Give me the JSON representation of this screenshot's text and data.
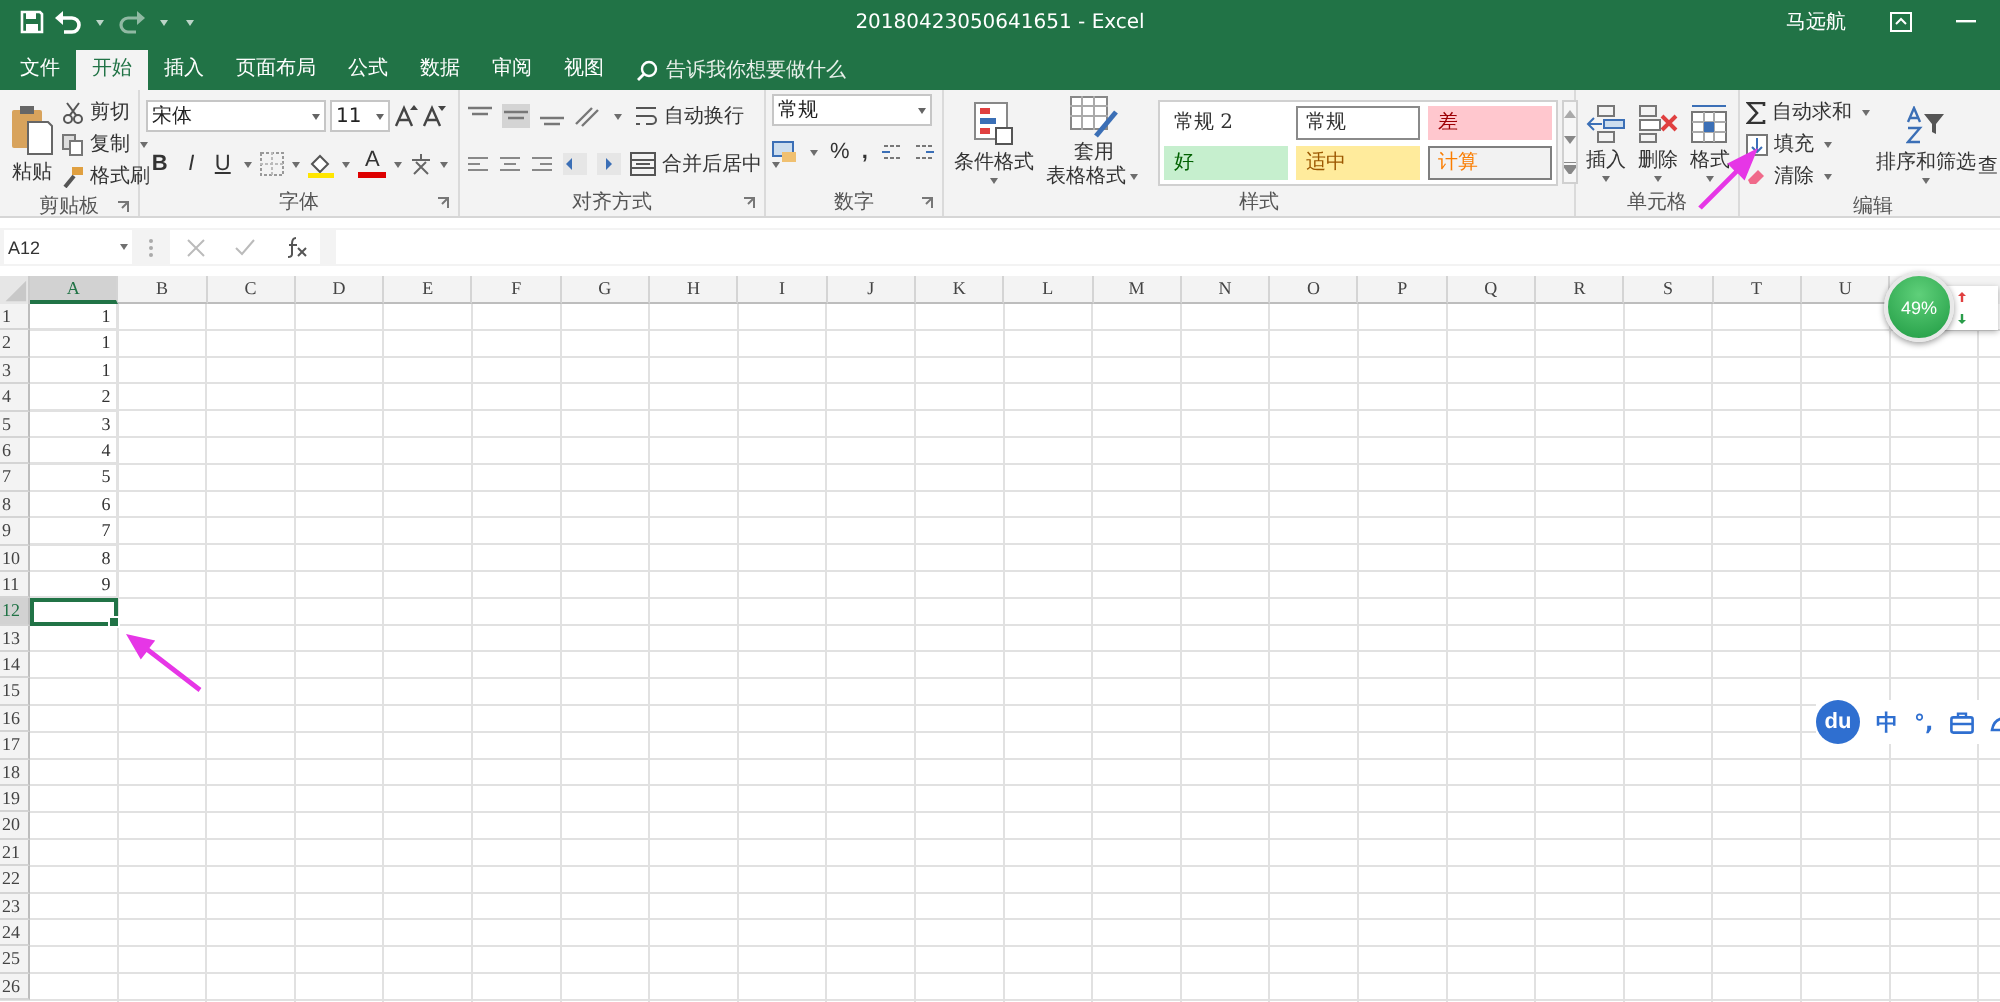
{
  "title_bar": {
    "title": "20180423050641651 - Excel",
    "user": "马远航"
  },
  "tabs": [
    {
      "label": "文件",
      "selected": false
    },
    {
      "label": "开始",
      "selected": true
    },
    {
      "label": "插入",
      "selected": false
    },
    {
      "label": "页面布局",
      "selected": false
    },
    {
      "label": "公式",
      "selected": false
    },
    {
      "label": "数据",
      "selected": false
    },
    {
      "label": "审阅",
      "selected": false
    },
    {
      "label": "视图",
      "selected": false
    }
  ],
  "tell_me": {
    "placeholder": "告诉我你想要做什么"
  },
  "clipboard": {
    "paste": "粘贴",
    "cut": "剪切",
    "copy": "复制",
    "format_painter": "格式刷",
    "label": "剪贴板"
  },
  "font": {
    "name": "宋体",
    "size": "11",
    "bold": "B",
    "italic": "I",
    "underline": "U",
    "font_color": "A",
    "label": "字体"
  },
  "alignment": {
    "wrap": "自动换行",
    "merge": "合并后居中",
    "label": "对齐方式"
  },
  "number": {
    "format": "常规",
    "percent": "%",
    "comma": ",",
    "label": "数字"
  },
  "styles": {
    "conditional": "条件格式",
    "table_top": "套用",
    "table_bottom": "表格格式",
    "label": "样式",
    "cell_styles": [
      {
        "label": "常规 2",
        "kind": "plain"
      },
      {
        "label": "常规",
        "kind": "outlined"
      },
      {
        "label": "差",
        "kind": "bad"
      },
      {
        "label": "好",
        "kind": "good"
      },
      {
        "label": "适中",
        "kind": "neutral"
      },
      {
        "label": "计算",
        "kind": "calculation"
      }
    ]
  },
  "cells_group": {
    "insert": "插入",
    "delete": "删除",
    "format": "格式",
    "label": "单元格"
  },
  "editing": {
    "autosum": "自动求和",
    "fill": "填充",
    "clear": "清除",
    "sort": "排序和筛选",
    "find": "查",
    "label": "编辑"
  },
  "formula_bar": {
    "name_box": "A12"
  },
  "sheet": {
    "columns": [
      {
        "label": "A",
        "selected": true
      },
      {
        "label": "B",
        "selected": false
      },
      {
        "label": "C",
        "selected": false
      },
      {
        "label": "D",
        "selected": false
      },
      {
        "label": "E",
        "selected": false
      },
      {
        "label": "F",
        "selected": false
      },
      {
        "label": "G",
        "selected": false
      },
      {
        "label": "H",
        "selected": false
      },
      {
        "label": "I",
        "selected": false
      },
      {
        "label": "J",
        "selected": false
      },
      {
        "label": "K",
        "selected": false
      },
      {
        "label": "L",
        "selected": false
      },
      {
        "label": "M",
        "selected": false
      },
      {
        "label": "N",
        "selected": false
      },
      {
        "label": "O",
        "selected": false
      },
      {
        "label": "P",
        "selected": false
      },
      {
        "label": "Q",
        "selected": false
      },
      {
        "label": "R",
        "selected": false
      },
      {
        "label": "S",
        "selected": false
      },
      {
        "label": "T",
        "selected": false
      },
      {
        "label": "U",
        "selected": false
      }
    ],
    "rows": [
      {
        "header": "1",
        "a": "1",
        "selected": false
      },
      {
        "header": "2",
        "a": "1",
        "selected": false
      },
      {
        "header": "3",
        "a": "1",
        "selected": false
      },
      {
        "header": "4",
        "a": "2",
        "selected": false
      },
      {
        "header": "5",
        "a": "3",
        "selected": false
      },
      {
        "header": "6",
        "a": "4",
        "selected": false
      },
      {
        "header": "7",
        "a": "5",
        "selected": false
      },
      {
        "header": "8",
        "a": "6",
        "selected": false
      },
      {
        "header": "9",
        "a": "7",
        "selected": false
      },
      {
        "header": "10",
        "a": "8",
        "selected": false
      },
      {
        "header": "11",
        "a": "9",
        "selected": false
      },
      {
        "header": "12",
        "selected": true
      },
      {
        "header": "13",
        "selected": false
      },
      {
        "header": "14",
        "selected": false
      },
      {
        "header": "15",
        "selected": false
      },
      {
        "header": "16",
        "selected": false
      },
      {
        "header": "17",
        "selected": false
      },
      {
        "header": "18",
        "selected": false
      },
      {
        "header": "19",
        "selected": false
      },
      {
        "header": "20",
        "selected": false
      },
      {
        "header": "21",
        "selected": false
      },
      {
        "header": "22",
        "selected": false
      },
      {
        "header": "23",
        "selected": false
      },
      {
        "header": "24",
        "selected": false
      },
      {
        "header": "25",
        "selected": false
      },
      {
        "header": "26",
        "selected": false
      }
    ]
  },
  "performance_widget": {
    "percent": "49%"
  },
  "ime_toolbar": {
    "logo": "du",
    "mode": "中",
    "punctuation": "°,"
  }
}
